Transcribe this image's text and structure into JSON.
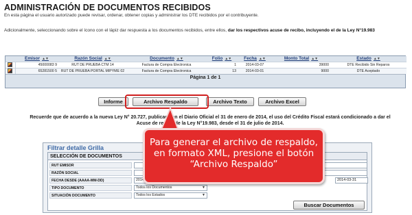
{
  "page": {
    "title": "ADMINISTRACIÓN DE DOCUMENTOS RECIBIDOS",
    "intro": "En esta página el usuario autorizado puede revisar, ordenar, obtener copias y administrar los DTE recibidos por el contribuyente.",
    "note_prefix": "Adicionalmente, seleccionando sobre el ícono con el lápiz dar respuesta a los documentos recibidos, entre ellos, ",
    "note_bold": "dar los respectivos acuse de recibo, incluyendo el de la Ley N°19.983"
  },
  "grid": {
    "columns": [
      {
        "label": "Emisor",
        "sort": "▲▼"
      },
      {
        "label": "Razón Social",
        "sort": "▲▼"
      },
      {
        "label": "Documento",
        "sort": "▲▼"
      },
      {
        "label": "Folio",
        "sort": "▲▼"
      },
      {
        "label": "Fecha",
        "sort": "▲▼"
      },
      {
        "label": "Monto Total",
        "sort": "▲▼"
      },
      {
        "label": "Estado",
        "sort": "▲▼"
      }
    ],
    "rows": [
      {
        "emisor": "45000083 9",
        "razon": "RUT DE PRUEBA CTM 14",
        "documento": "Factura de Compra Electronica",
        "folio": "1",
        "fecha": "2014-03-07",
        "monto": "39000",
        "estado": "DTE Recibido Sin Reparos"
      },
      {
        "emisor": "65281500 5",
        "razon": "RUT DE PRUEBA PORTAL MIPYME 02",
        "documento": "Factura de Compra Electronica",
        "folio": "13",
        "fecha": "2014-03-01",
        "monto": "9000",
        "estado": "DTE Aceptado"
      }
    ],
    "footer": "Página 1 de 1"
  },
  "buttons": {
    "informe": "Informe",
    "respaldo": "Archivo Respaldo",
    "texto": "Archivo Texto",
    "excel": "Archivo Excel"
  },
  "reminder": {
    "line1": "Recuerde que de acuerdo a la nueva Ley N° 20.727, publicada en el Diario Oficial el 31 de enero de 2014, el uso del Crédito Fiscal estará condicionado a dar el",
    "line2": "Acuse de recibo de la Ley N°19.983, desde el 31 de julio de 2014."
  },
  "filter": {
    "title": "Filtrar detalle Grilla",
    "header": "SELECCIÓN DE DOCUMENTOS",
    "fields": {
      "rut_emisor": "RUT EMISOR",
      "razon_social": "RAZÓN SOCIAL",
      "fecha_desde": "FECHA DESDE (AAAA-MM-DD)",
      "tipo_documento": "TIPO DOCUMENTO",
      "situacion_documento": "SITUACIÓN DOCUMENTO"
    },
    "fecha_desde_value": "2014-",
    "fecha_hasta_value": "2014-03-31",
    "tipo_documento_value": "Todos los Documentos",
    "situacion_documento_value": "Todos los Estados",
    "search_button": "Buscar Documentos"
  },
  "callout": {
    "line1": "Para generar el archivo de respaldo,",
    "line2": "en formato XML, presione el botón",
    "line3": "“Archivo Respaldo”"
  },
  "colors": {
    "accent_red": "#e32b2b",
    "header_blue": "#1f3c78",
    "filter_title_blue": "#3f6aa6"
  }
}
